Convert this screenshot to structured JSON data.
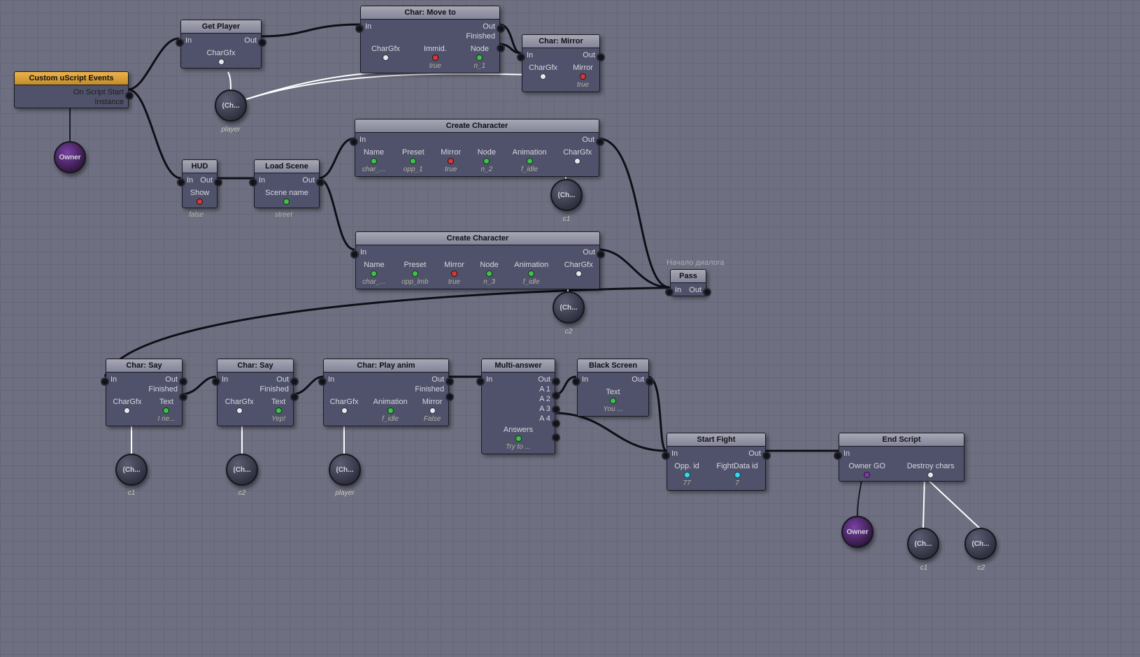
{
  "annotations": {
    "pass_comment": "Начало диалога"
  },
  "nodes": {
    "events": {
      "title": "Custom uScript Events",
      "out1": "On Script Start",
      "p1": "Instance"
    },
    "owner1": "Owner",
    "getPlayer": {
      "title": "Get Player",
      "in": "In",
      "out": "Out",
      "p": "CharGfx"
    },
    "player_bubble": "(Ch...",
    "player_bubble_lbl": "player",
    "hud": {
      "title": "HUD",
      "in": "In",
      "out": "Out",
      "p": "Show",
      "pval": "false"
    },
    "loadScene": {
      "title": "Load Scene",
      "in": "In",
      "out": "Out",
      "p": "Scene name",
      "pval": "street"
    },
    "moveTo": {
      "title": "Char: Move to",
      "in": "In",
      "out": "Out",
      "fin": "Finished",
      "p1": "CharGfx",
      "p2": "Immid.",
      "p2v": "true",
      "p3": "Node",
      "p3v": "n_1"
    },
    "mirror": {
      "title": "Char: Mirror",
      "in": "In",
      "out": "Out",
      "p1": "CharGfx",
      "p2": "Mirror",
      "p2v": "true"
    },
    "cc1": {
      "title": "Create Character",
      "in": "In",
      "out": "Out",
      "p1": "Name",
      "p1v": "char_...",
      "p2": "Preset",
      "p2v": "opp_1",
      "p3": "Mirror",
      "p3v": "true",
      "p4": "Node",
      "p4v": "n_2",
      "p5": "Animation",
      "p5v": "f_idle",
      "p6": "CharGfx"
    },
    "c1_bubble": "(Ch...",
    "c1_lbl": "c1",
    "cc2": {
      "title": "Create Character",
      "in": "In",
      "out": "Out",
      "p1": "Name",
      "p1v": "char_...",
      "p2": "Preset",
      "p2v": "opp_lmb",
      "p3": "Mirror",
      "p3v": "true",
      "p4": "Node",
      "p4v": "n_3",
      "p5": "Animation",
      "p5v": "f_idle",
      "p6": "CharGfx"
    },
    "c2_bubble": "(Ch...",
    "c2_lbl": "c2",
    "pass": {
      "title": "Pass",
      "in": "In",
      "out": "Out"
    },
    "say1": {
      "title": "Char: Say",
      "in": "In",
      "out": "Out",
      "fin": "Finished",
      "p1": "CharGfx",
      "p2": "Text",
      "p2v": "I ne..."
    },
    "say1_bubble": "(Ch...",
    "say1_lbl": "c1",
    "say2": {
      "title": "Char: Say",
      "in": "In",
      "out": "Out",
      "fin": "Finished",
      "p1": "CharGfx",
      "p2": "Text",
      "p2v": "Yep!"
    },
    "say2_bubble": "(Ch...",
    "say2_lbl": "c2",
    "play": {
      "title": "Char: Play anim",
      "in": "In",
      "out": "Out",
      "fin": "Finished",
      "p1": "CharGfx",
      "p2": "Animation",
      "p2v": "f_idle",
      "p3": "Mirror",
      "p3v": "False"
    },
    "play_bubble": "(Ch...",
    "play_lbl": "player",
    "multi": {
      "title": "Multi-answer",
      "in": "In",
      "out": "Out",
      "a1": "A 1",
      "a2": "A 2",
      "a3": "A 3",
      "a4": "A 4",
      "pA": "Answers",
      "pAv": "Try to ..."
    },
    "black": {
      "title": "Black Screen",
      "in": "In",
      "out": "Out",
      "p1": "Text",
      "p1v": "You ..."
    },
    "fight": {
      "title": "Start Fight",
      "in": "In",
      "out": "Out",
      "p1": "Opp. id",
      "p1v": "77",
      "p2": "FightData id",
      "p2v": "7"
    },
    "end": {
      "title": "End Script",
      "in": "In",
      "p1": "Owner GO",
      "p2": "Destroy chars"
    },
    "owner2": "Owner",
    "end_c1": "(Ch...",
    "end_c1_lbl": "c1",
    "end_c2": "(Ch...",
    "end_c2_lbl": "c2"
  }
}
